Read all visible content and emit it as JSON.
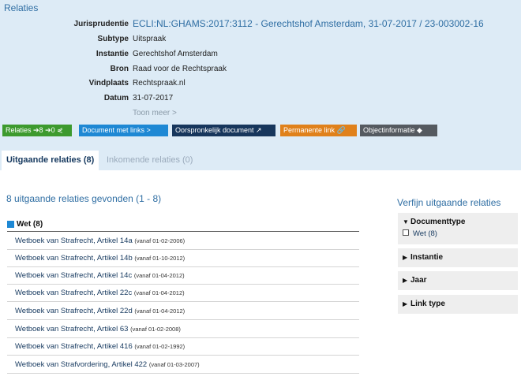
{
  "page": {
    "title": "Relaties"
  },
  "metadata": [
    {
      "label": "Jurisprudentie",
      "value": "ECLI:NL:GHAMS:2017:3112 - Gerechtshof Amsterdam, 31-07-2017 / 23-003002-16"
    },
    {
      "label": "Subtype",
      "value": "Uitspraak"
    },
    {
      "label": "Instantie",
      "value": "Gerechtshof Amsterdam"
    },
    {
      "label": "Bron",
      "value": "Raad voor de Rechtspraak"
    },
    {
      "label": "Vindplaats",
      "value": "Rechtspraak.nl"
    },
    {
      "label": "Datum",
      "value": "31-07-2017"
    }
  ],
  "toon_meer": "Toon meer >",
  "buttons": {
    "relaties": "Relaties ➔8 ➔0 ⋞",
    "document_met_links": "Document met links >",
    "oorspronkelijk": "Oorspronkelijk document ↗",
    "permanente_link": "Permanente link 🔗",
    "objectinformatie": "Objectinformatie ◆"
  },
  "tabs": {
    "uitgaande": "Uitgaande relaties (8)",
    "inkomende": "Inkomende relaties (0)"
  },
  "results_summary": "8 uitgaande relaties gevonden (1 - 8)",
  "group": {
    "label": "Wet (8)"
  },
  "relations": [
    {
      "title": "Wetboek van Strafrecht, Artikel 14a",
      "date": "(vanaf 01-02-2006)"
    },
    {
      "title": "Wetboek van Strafrecht, Artikel 14b",
      "date": "(vanaf 01-10-2012)"
    },
    {
      "title": "Wetboek van Strafrecht, Artikel 14c",
      "date": "(vanaf 01-04-2012)"
    },
    {
      "title": "Wetboek van Strafrecht, Artikel 22c",
      "date": "(vanaf 01-04-2012)"
    },
    {
      "title": "Wetboek van Strafrecht, Artikel 22d",
      "date": "(vanaf 01-04-2012)"
    },
    {
      "title": "Wetboek van Strafrecht, Artikel 63",
      "date": "(vanaf 01-02-2008)"
    },
    {
      "title": "Wetboek van Strafrecht, Artikel 416",
      "date": "(vanaf 01-02-1992)"
    },
    {
      "title": "Wetboek van Strafvordering, Artikel 422",
      "date": "(vanaf 01-03-2007)"
    }
  ],
  "filter": {
    "title": "Verfijn uitgaande relaties",
    "facets": [
      {
        "label": "Documenttype",
        "expanded": true,
        "options": [
          {
            "label": "Wet (8)",
            "checked": false
          }
        ]
      },
      {
        "label": "Instantie",
        "expanded": false
      },
      {
        "label": "Jaar",
        "expanded": false
      },
      {
        "label": "Link type",
        "expanded": false
      }
    ]
  },
  "colors": {
    "header_bg": "#ddebf6",
    "link_blue": "#2f6ea3",
    "btn_green": "#3d9a2e",
    "btn_blue": "#1e88d4",
    "btn_navy": "#17365c",
    "btn_orange": "#e0811b",
    "btn_gray": "#555a60"
  }
}
